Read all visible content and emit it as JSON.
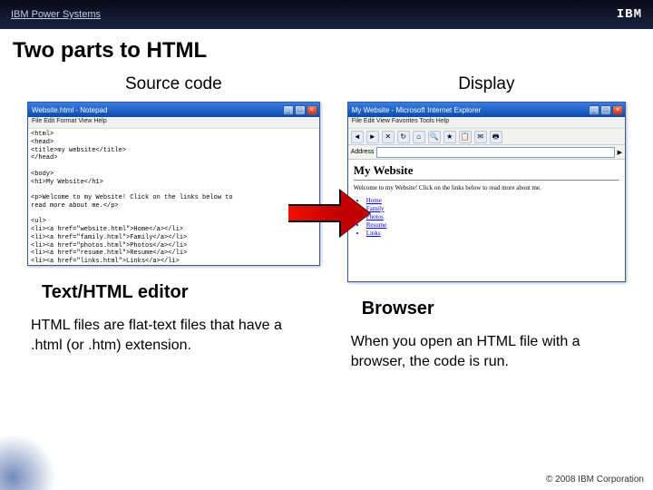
{
  "header": {
    "brand": "IBM Power Systems",
    "logo": "IBM"
  },
  "title": "Two parts to HTML",
  "left": {
    "label": "Source code",
    "window_title": "Website.html - Notepad",
    "menu": "File  Edit  Format  View  Help",
    "code": "<html>\n<head>\n<title>my website</title>\n</head>\n\n<body>\n<h1>My Website</h1>\n\n<p>Welcome to my Website! Click on the links below to\nread more about me.</p>\n\n<ul>\n<li><a href=\"website.html\">Home</a></li>\n<li><a href=\"family.html\">Family</a></li>\n<li><a href=\"photos.html\">Photos</a></li>\n<li><a href=\"resume.html\">Resume</a></li>\n<li><a href=\"links.html\">Links</a></li>\n</ul>\n\n</body>\n</html>",
    "subtitle": "Text/HTML editor",
    "desc": "HTML files are flat-text files that have a .html (or .htm) extension."
  },
  "right": {
    "label": "Display",
    "window_title": "My Website - Microsoft Internet Explorer",
    "menu": "File  Edit  View  Favorites  Tools  Help",
    "addr_label": "Address",
    "page_title": "My Website",
    "page_text": "Welcome to my Website! Click on the links below to read more about me.",
    "links": [
      "Home",
      "Family",
      "Photos",
      "Resume",
      "Links"
    ],
    "subtitle": "Browser",
    "desc": "When you open an HTML file with a browser, the code is run."
  },
  "copyright": "© 2008 IBM Corporation"
}
